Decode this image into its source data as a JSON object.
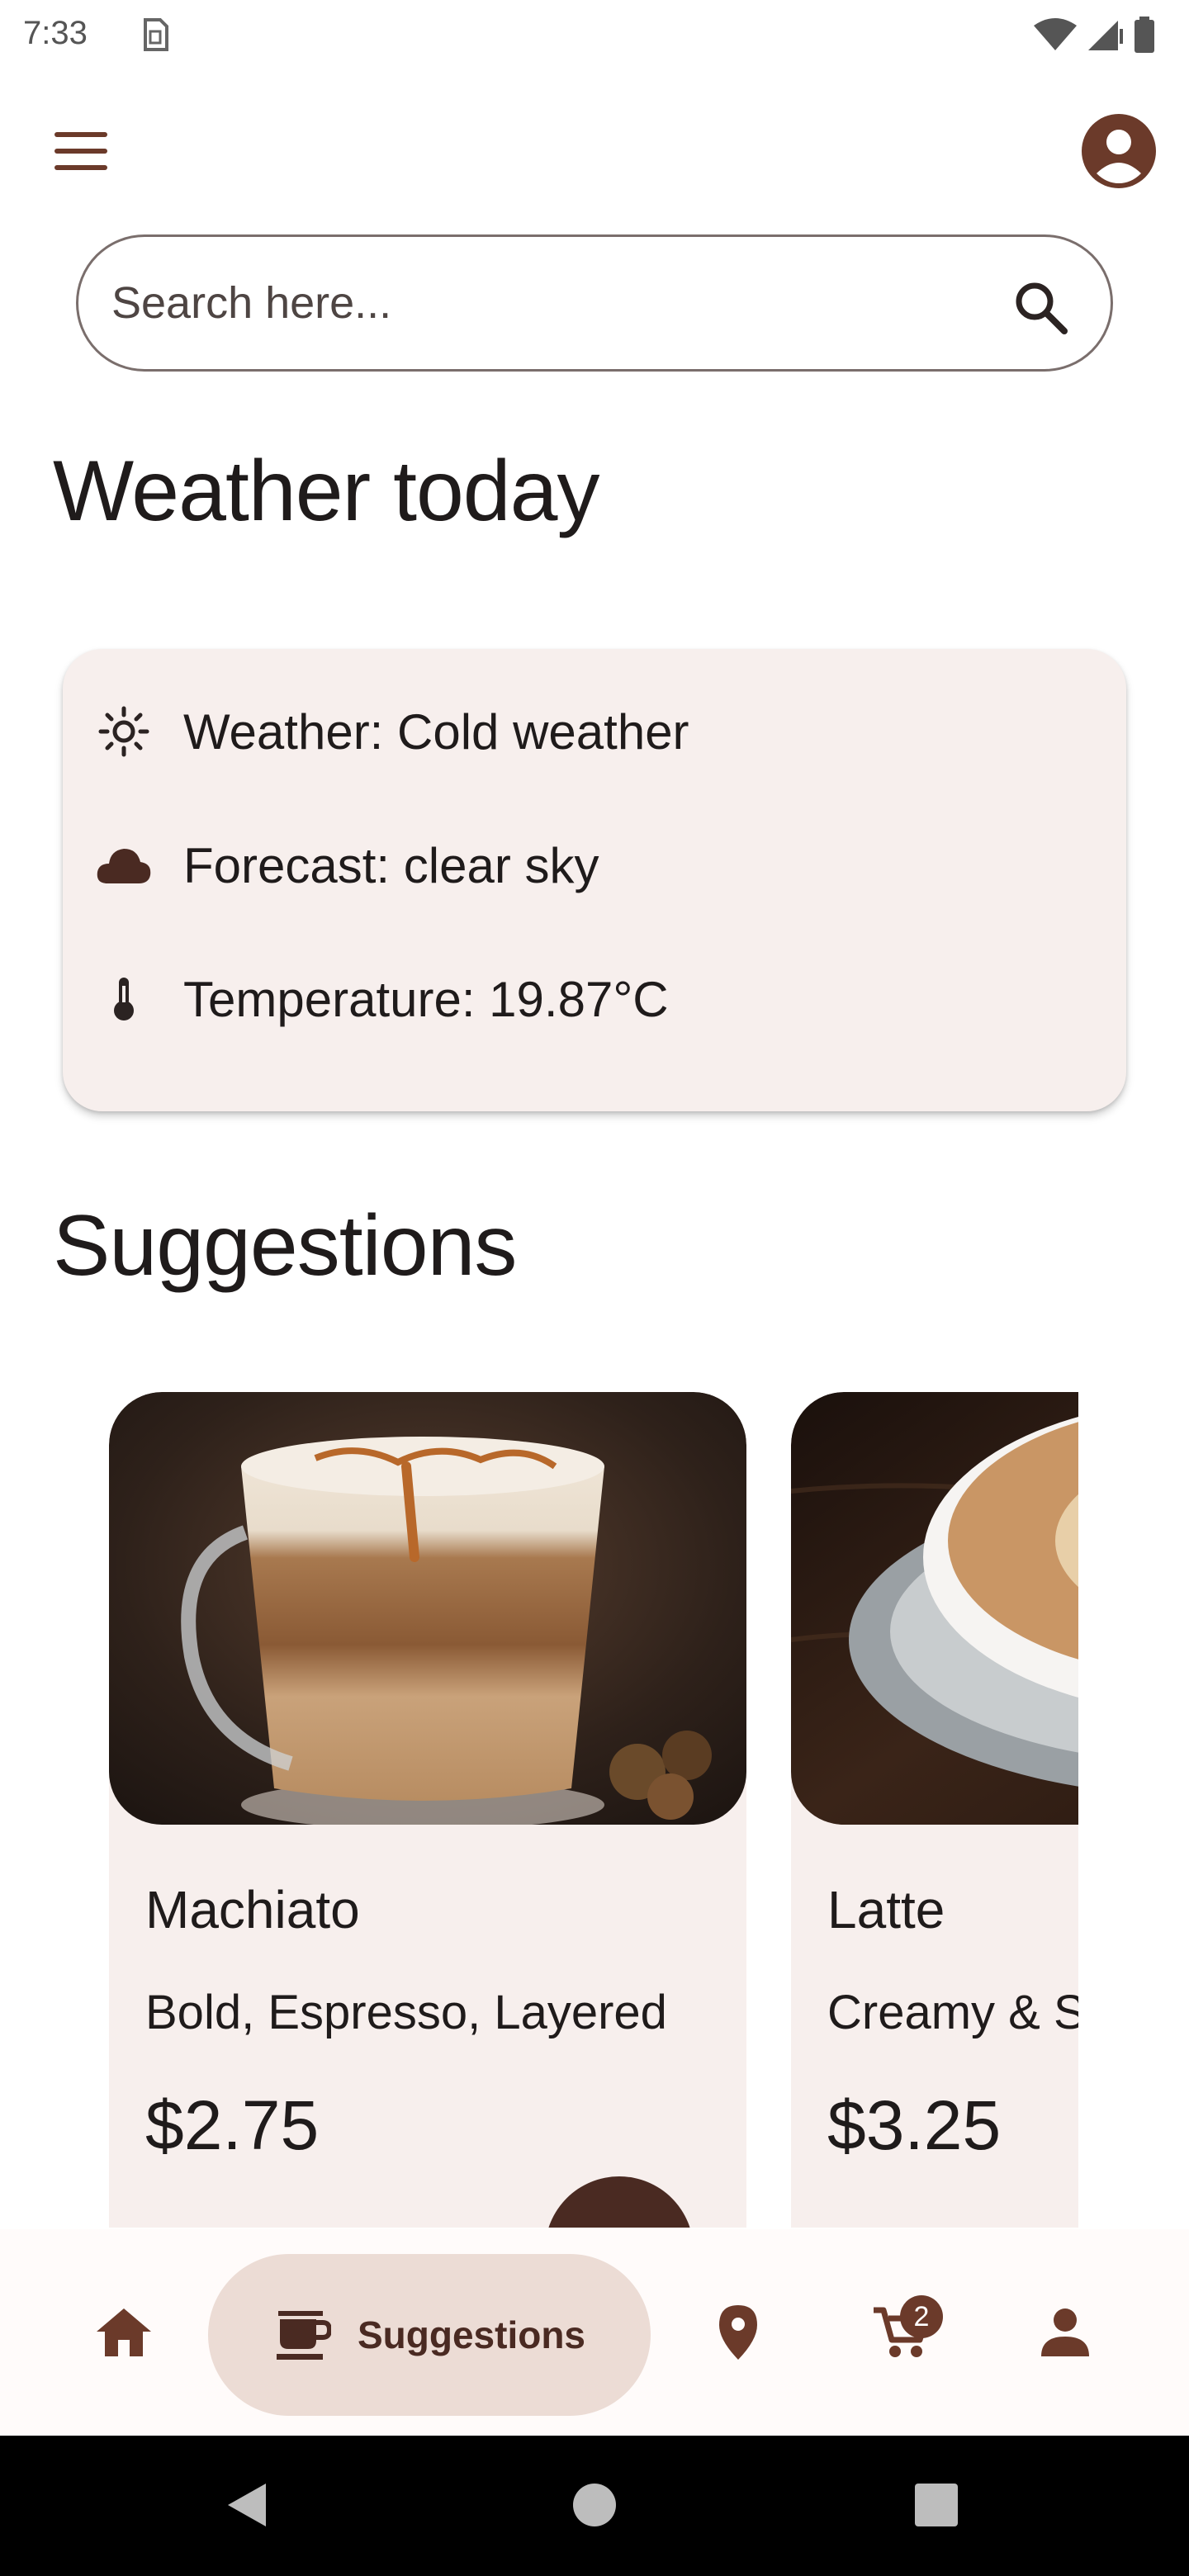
{
  "status_bar": {
    "time": "7:33"
  },
  "app_bar": {
    "menu_icon": "menu-icon",
    "avatar_icon": "account-circle-icon"
  },
  "search": {
    "placeholder": "Search here..."
  },
  "weather": {
    "title": "Weather today",
    "rows": [
      {
        "icon": "sun-icon",
        "text": "Weather: Cold weather"
      },
      {
        "icon": "cloud-icon",
        "text": "Forecast: clear sky"
      },
      {
        "icon": "thermometer-icon",
        "text": "Temperature: 19.87°C"
      }
    ]
  },
  "suggestions": {
    "title": "Suggestions",
    "items": [
      {
        "name": "Machiato",
        "desc": "Bold, Espresso, Layered",
        "price": "$2.75"
      },
      {
        "name": "Latte",
        "desc": "Creamy & S",
        "price": "$3.25"
      }
    ]
  },
  "bottom_nav": {
    "items": [
      {
        "icon": "home-icon",
        "label": ""
      },
      {
        "icon": "coffee-cup-icon",
        "label": "Suggestions",
        "selected": true
      },
      {
        "icon": "location-pin-icon",
        "label": ""
      },
      {
        "icon": "shopping-cart-icon",
        "label": "",
        "badge": "2"
      },
      {
        "icon": "person-icon",
        "label": ""
      }
    ]
  },
  "colors": {
    "accent": "#6b3a2a",
    "card_bg": "#f7efed",
    "nav_pill": "#ecdcd5",
    "dark_brown": "#4a2a22"
  }
}
